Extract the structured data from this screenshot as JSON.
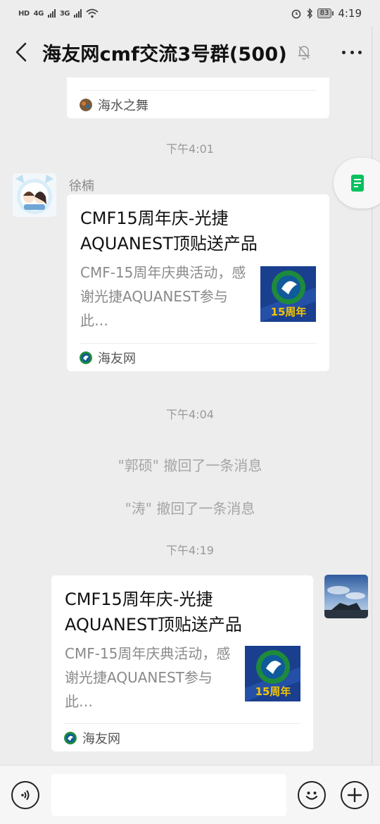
{
  "status_bar": {
    "network_badge": "HD",
    "sim1": "4G",
    "sim2": "3G",
    "battery": "83",
    "time": "4:19"
  },
  "header": {
    "title": "海友网cmf交流3号群(500)"
  },
  "messages": {
    "partial_card": {
      "source_name": "海水之舞"
    },
    "timestamp_1": "下午4:01",
    "incoming": {
      "sender": "徐楠",
      "card_title": "CMF15周年庆-光捷AQUANEST顶贴送产品",
      "card_desc": "CMF-15周年庆典活动，感谢光捷AQUANEST参与此…",
      "thumb_text": "15周年",
      "source_name": "海友网"
    },
    "timestamp_2": "下午4:04",
    "recall_1": "\"郭硕\" 撤回了一条消息",
    "recall_2": "\"涛\" 撤回了一条消息",
    "timestamp_3": "下午4:19",
    "outgoing": {
      "card_title": "CMF15周年庆-光捷AQUANEST顶贴送产品",
      "card_desc": "CMF-15周年庆典活动，感谢光捷AQUANEST参与此…",
      "thumb_text": "15周年",
      "source_name": "海友网"
    }
  },
  "icons": [
    "back-arrow-icon",
    "mute-bell-icon",
    "more-icon",
    "notes-icon",
    "voice-icon",
    "emoji-icon",
    "add-icon"
  ],
  "colors": {
    "background": "#ededed",
    "card": "#ffffff",
    "accent_green": "#07c160"
  }
}
